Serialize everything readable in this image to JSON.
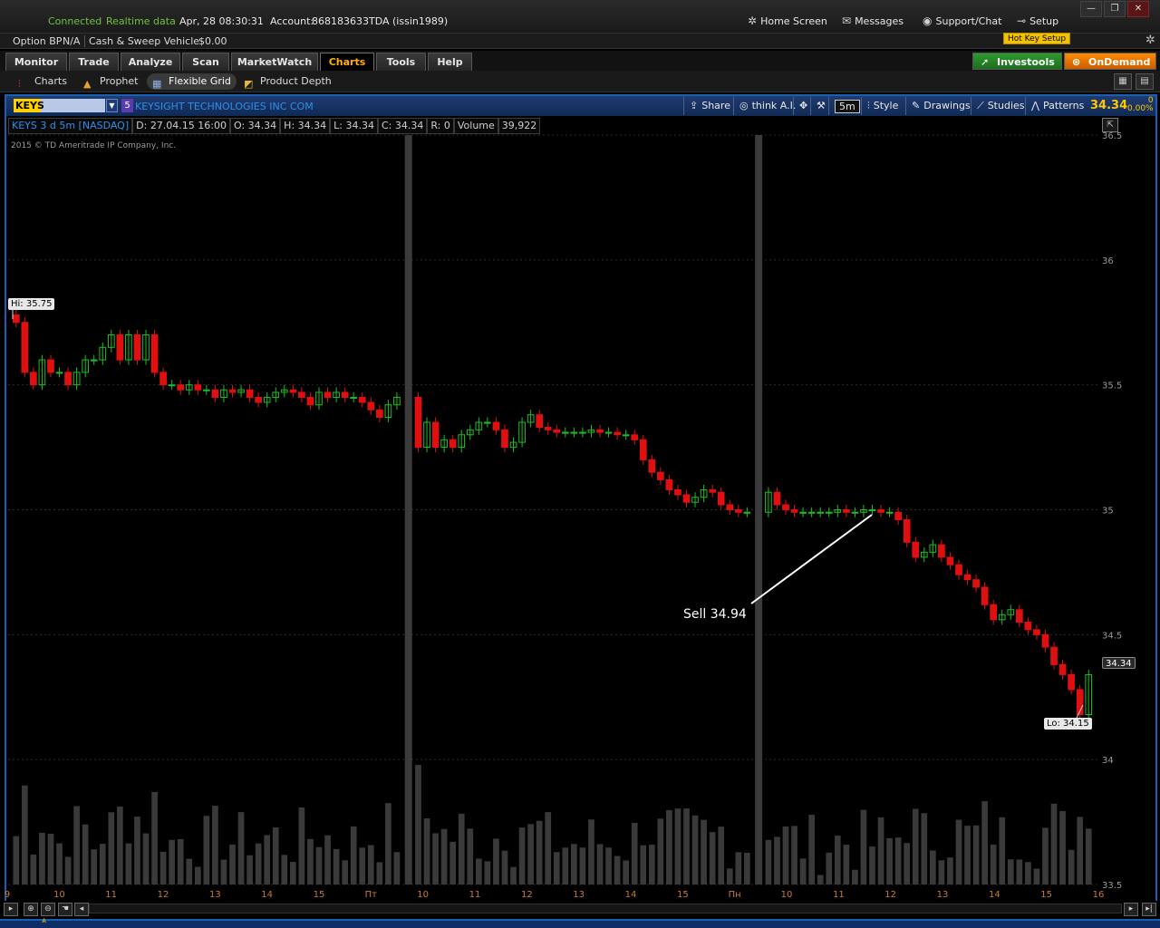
{
  "status": {
    "connection": "Connected",
    "data_mode": "Realtime data",
    "datetime": "Apr, 28  08:30:31",
    "account_label": "Account:",
    "account": "868183633TDA (issin1989)"
  },
  "top_nav": [
    {
      "label": "Home Screen",
      "icon": "home-icon"
    },
    {
      "label": "Messages",
      "icon": "envelope-icon"
    },
    {
      "label": "Support/Chat",
      "icon": "chat-icon"
    },
    {
      "label": "Setup",
      "icon": "setup-icon"
    }
  ],
  "account_bar": {
    "option_bp_label": "Option BP",
    "option_bp_value": "N/A",
    "cash_label": "Cash & Sweep Vehicle",
    "cash_value": "$0.00",
    "hotkey_label": "Hot Key Setup"
  },
  "main_tabs": [
    "Monitor",
    "Trade",
    "Analyze",
    "Scan",
    "MarketWatch",
    "Charts",
    "Tools",
    "Help"
  ],
  "active_tab": "Charts",
  "side_buttons": {
    "investools": "Investools",
    "ondemand": "OnDemand"
  },
  "sub_tabs": [
    "Charts",
    "Prophet",
    "Flexible Grid",
    "Product Depth"
  ],
  "active_sub_tab": "Flexible Grid",
  "chart_header": {
    "symbol": "KEYS",
    "index_badge": "5",
    "company": "KEYSIGHT TECHNOLOGIES INC COM",
    "buttons": [
      "Share",
      "think A.I.",
      "5m",
      "Style",
      "Drawings",
      "Studies",
      "Patterns"
    ],
    "last_price": "34.34",
    "change": "0",
    "change_pct": "0.00%"
  },
  "info_bar": {
    "desc": "KEYS 3 d 5m [NASDAQ]",
    "date": "D: 27.04.15 16:00",
    "open": "O: 34.34",
    "high": "H: 34.34",
    "low": "L: 34.34",
    "close": "C: 34.34",
    "range": "R: 0",
    "volume_label": "Volume",
    "volume_value": "39,922"
  },
  "copyright": "2015 © TD Ameritrade IP Company, Inc.",
  "annotations": {
    "hi": "Hi: 35.75",
    "lo": "Lo: 34.15",
    "current": "34.34",
    "sell": "Sell 34.94"
  },
  "colors": {
    "up": "#1dbf22",
    "down": "#e01010",
    "volume": "#3a3a3a",
    "accent": "#ffb000",
    "frame": "#1b5fb5"
  },
  "chart_data": {
    "type": "candlestick",
    "y_ticks": [
      "36.5",
      "36",
      "35.5",
      "35",
      "34.5",
      "34",
      "33.5"
    ],
    "ylim": [
      33.5,
      36.5
    ],
    "x_ticks": [
      "9",
      "10",
      "11",
      "12",
      "13",
      "14",
      "15",
      "Пт",
      "10",
      "11",
      "12",
      "13",
      "14",
      "15",
      "Пн",
      "10",
      "11",
      "12",
      "13",
      "14",
      "15",
      "16"
    ],
    "segments": [
      {
        "name": "day1",
        "closes": [
          35.75,
          35.55,
          35.5,
          35.6,
          35.55,
          35.55,
          35.5,
          35.55,
          35.6,
          35.6,
          35.65,
          35.7,
          35.6,
          35.7,
          35.6,
          35.7,
          35.55,
          35.5,
          35.5,
          35.48,
          35.5,
          35.48,
          35.48,
          35.45,
          35.48,
          35.47,
          35.48,
          35.45,
          35.43,
          35.45,
          35.47,
          35.48,
          35.47,
          35.45,
          35.42,
          35.47,
          35.45,
          35.47,
          35.45,
          35.45,
          35.43,
          35.4,
          35.37,
          35.42,
          35.45
        ]
      },
      {
        "name": "day2",
        "closes": [
          35.25,
          35.35,
          35.25,
          35.28,
          35.25,
          35.3,
          35.32,
          35.35,
          35.35,
          35.32,
          35.25,
          35.27,
          35.35,
          35.38,
          35.33,
          35.32,
          35.31,
          35.31,
          35.31,
          35.31,
          35.32,
          35.31,
          35.31,
          35.3,
          35.3,
          35.28,
          35.2,
          35.15,
          35.12,
          35.08,
          35.06,
          35.03,
          35.05,
          35.08,
          35.07,
          35.02,
          35.0,
          34.99,
          34.99
        ]
      },
      {
        "name": "day3",
        "closes": [
          35.07,
          35.02,
          35.0,
          34.99,
          34.99,
          34.99,
          34.99,
          34.99,
          35.0,
          34.99,
          34.99,
          35.0,
          35.0,
          34.99,
          34.99,
          34.96,
          34.87,
          34.81,
          34.83,
          34.86,
          34.81,
          34.78,
          34.74,
          34.72,
          34.69,
          34.62,
          34.56,
          34.58,
          34.6,
          34.55,
          34.52,
          34.5,
          34.45,
          34.38,
          34.34,
          34.28,
          34.18,
          34.34
        ]
      }
    ]
  }
}
